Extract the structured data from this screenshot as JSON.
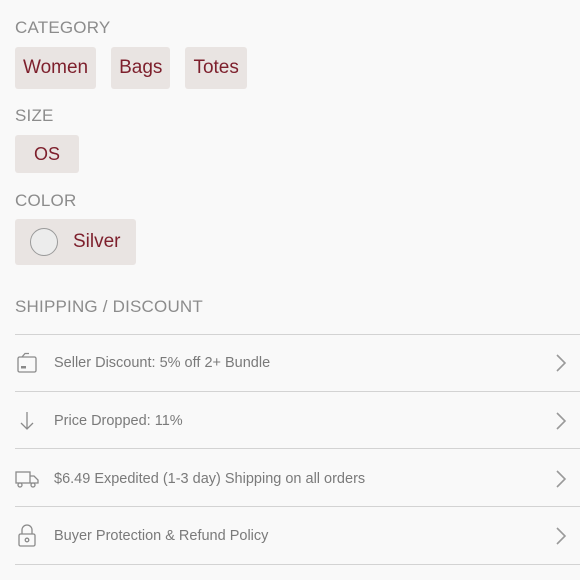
{
  "category": {
    "label": "CATEGORY",
    "chips": [
      "Women",
      "Bags",
      "Totes"
    ]
  },
  "size": {
    "label": "SIZE",
    "chips": [
      "OS"
    ]
  },
  "color": {
    "label": "COLOR",
    "value": "Silver",
    "swatch_color": "#ececec"
  },
  "shipping": {
    "label": "SHIPPING / DISCOUNT",
    "rows": [
      {
        "icon": "bundle-icon",
        "text": "Seller Discount: 5% off 2+ Bundle"
      },
      {
        "icon": "arrow-down-icon",
        "text": "Price Dropped: 11%"
      },
      {
        "icon": "truck-icon",
        "text": "$6.49 Expedited (1-3 day) Shipping on all orders"
      },
      {
        "icon": "lock-icon",
        "text": "Buyer Protection & Refund Policy"
      }
    ]
  },
  "colors": {
    "accent": "#7d1f2c",
    "chip_bg": "#e9e4e2",
    "divider": "#d3d3d3"
  }
}
